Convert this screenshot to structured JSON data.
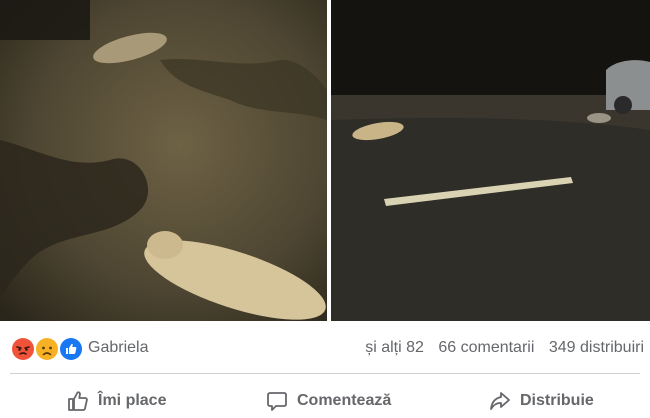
{
  "post": {
    "reactions": {
      "icons": [
        "angry-icon",
        "sad-icon",
        "like-icon"
      ],
      "colors": {
        "angry": "#f0533a",
        "sad": "#f7b125",
        "like": "#1877f2"
      },
      "first_reactor": "Gabriela"
    },
    "stats": {
      "others": "și alți 82",
      "comments": "66 comentarii",
      "shares": "349 distribuiri"
    },
    "actions": {
      "like": "Îmi place",
      "comment": "Comentează",
      "share": "Distribuie"
    },
    "text_color": "#65676b"
  }
}
